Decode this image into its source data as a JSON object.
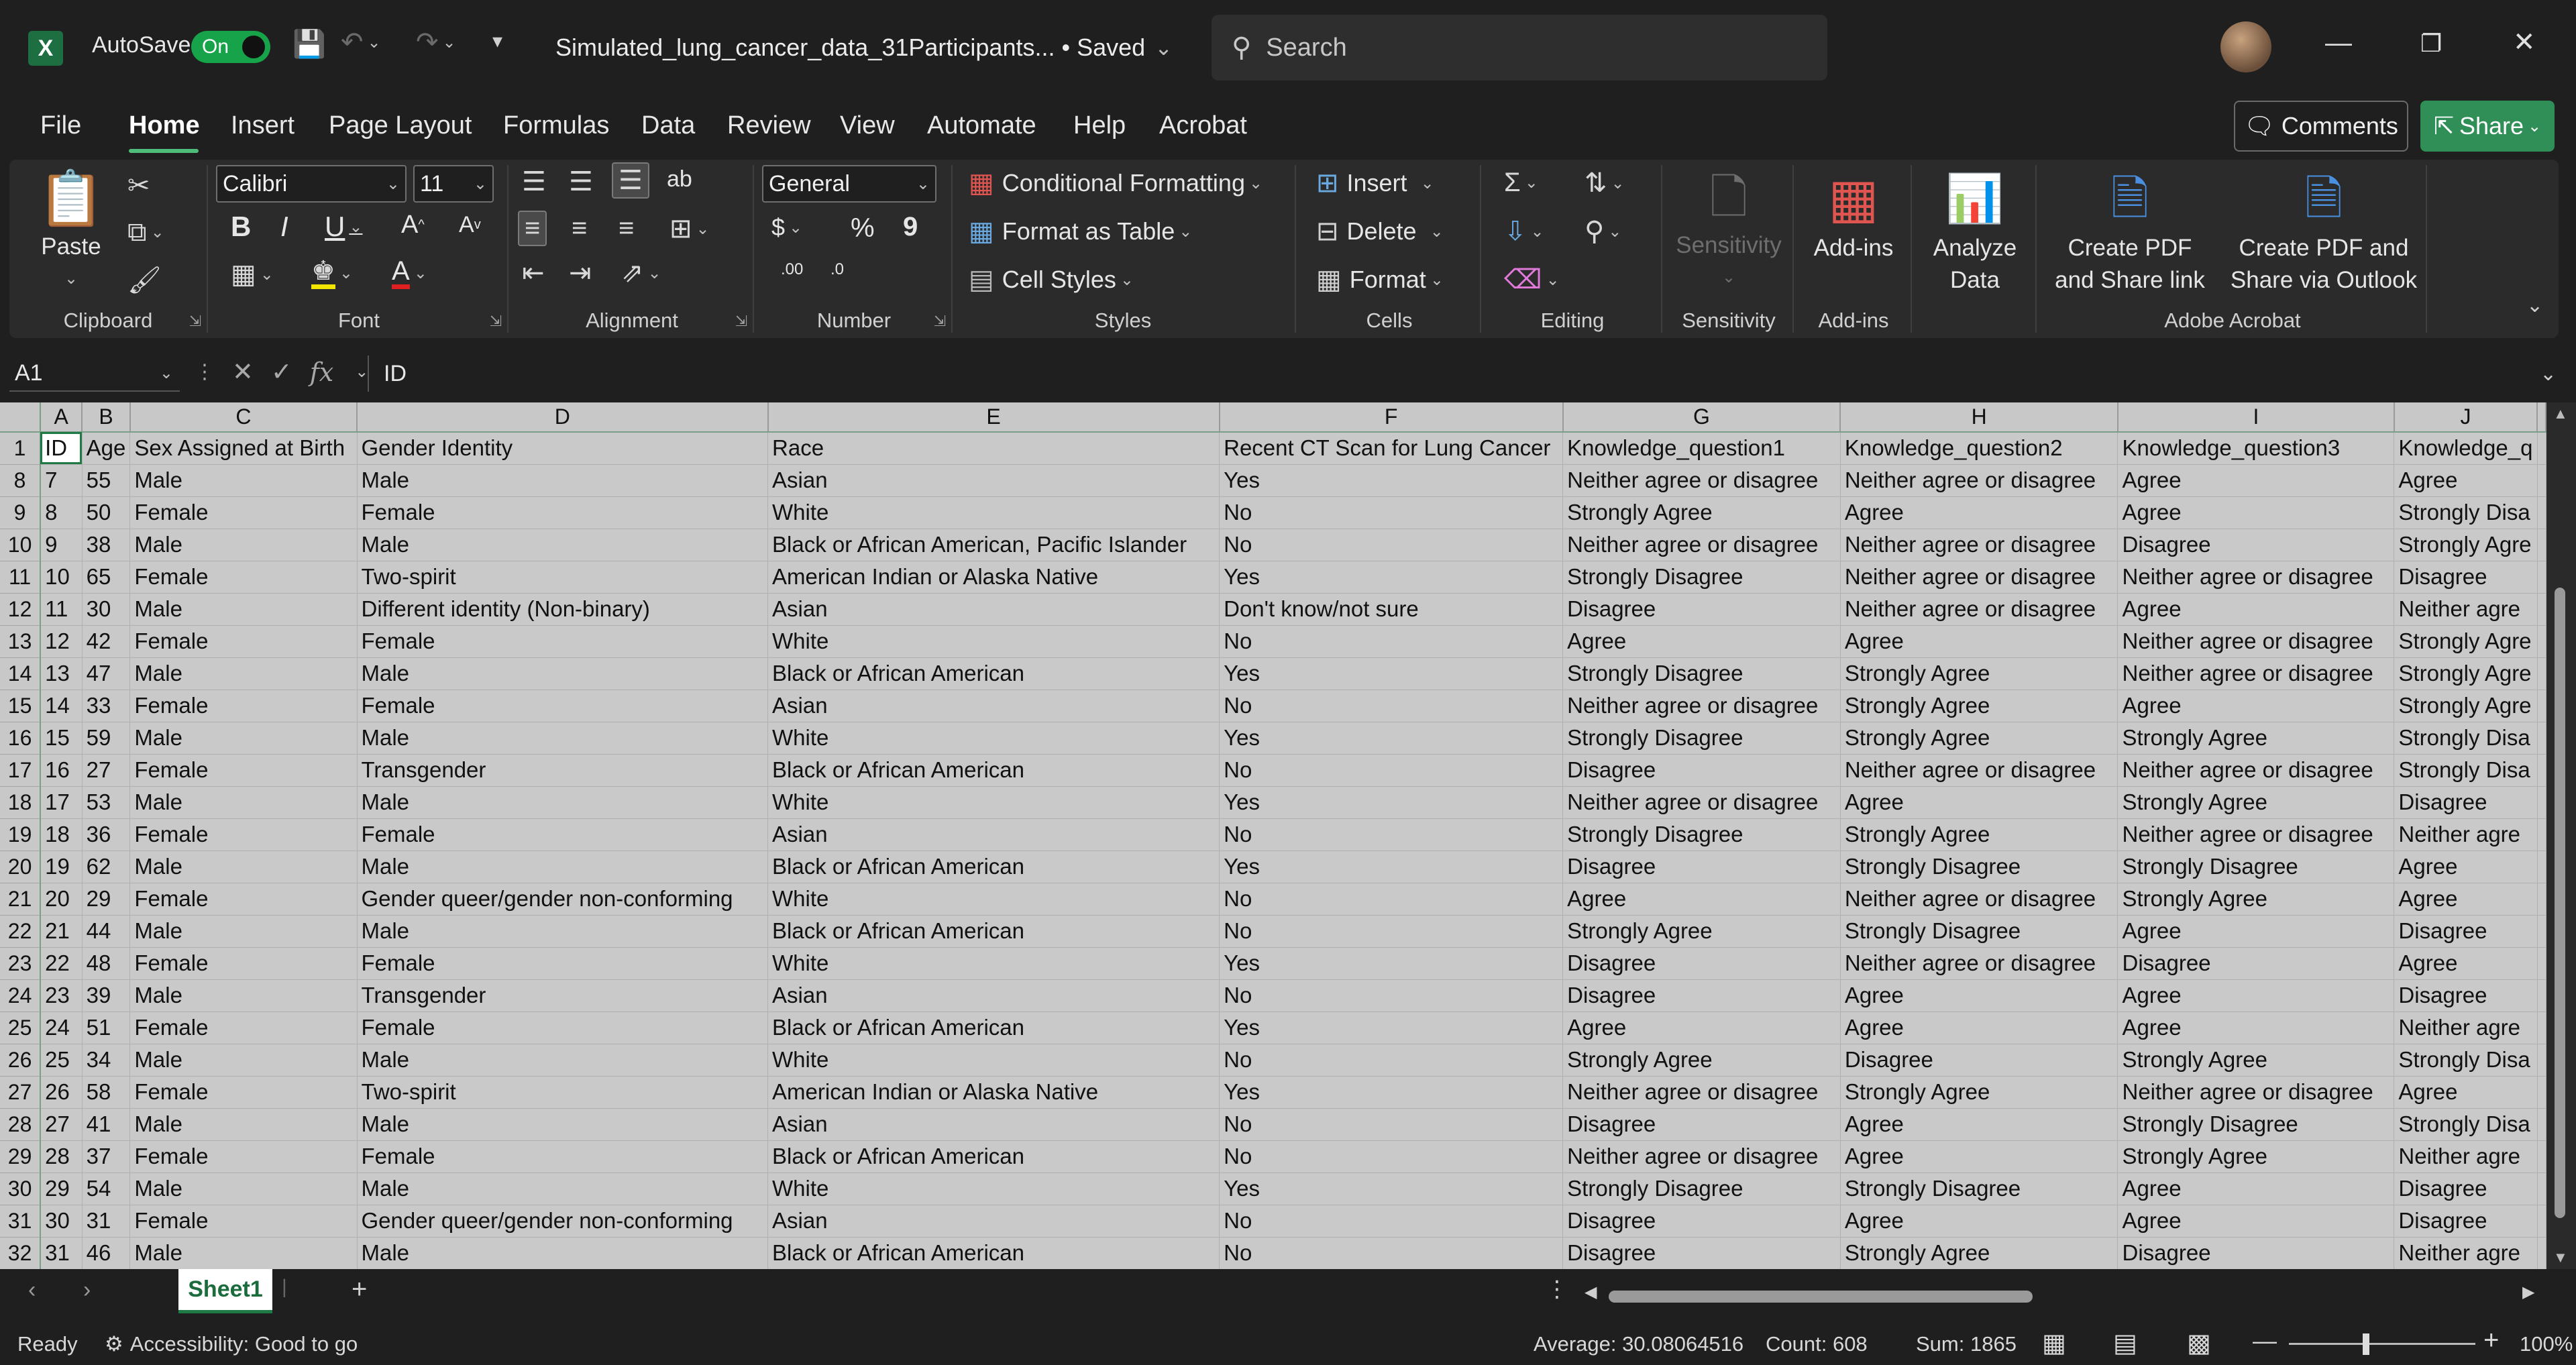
{
  "titlebar": {
    "app_logo": "X",
    "autosave_label": "AutoSave",
    "autosave_state": "On",
    "file_title": "Simulated_lung_cancer_data_31Participants... • Saved",
    "search_placeholder": "Search"
  },
  "menu": {
    "tabs": [
      "File",
      "Home",
      "Insert",
      "Page Layout",
      "Formulas",
      "Data",
      "Review",
      "View",
      "Automate",
      "Help",
      "Acrobat"
    ],
    "comments_label": "Comments",
    "share_label": "Share"
  },
  "ribbon": {
    "clipboard": {
      "paste": "Paste",
      "label": "Clipboard"
    },
    "font": {
      "name": "Calibri",
      "size": "11",
      "label": "Font"
    },
    "alignment": {
      "label": "Alignment"
    },
    "number": {
      "format": "General",
      "label": "Number"
    },
    "styles": {
      "conditional": "Conditional Formatting",
      "table": "Format as Table",
      "cell_styles": "Cell Styles",
      "label": "Styles"
    },
    "cells": {
      "insert": "Insert",
      "delete": "Delete",
      "format": "Format",
      "label": "Cells"
    },
    "editing": {
      "label": "Editing"
    },
    "sensitivity": {
      "button": "Sensitivity",
      "label": "Sensitivity"
    },
    "addins": {
      "button": "Add-ins",
      "label": "Add-ins"
    },
    "analyze": {
      "line1": "Analyze",
      "line2": "Data"
    },
    "acrobat": {
      "pdf_share_1": "Create PDF",
      "pdf_share_2": "and Share link",
      "pdf_outlook_1": "Create PDF and",
      "pdf_outlook_2": "Share via Outlook",
      "label": "Adobe Acrobat"
    },
    "number_symbols": {
      "currency": "$",
      "percent": "%",
      "comma": "9",
      "inc_dec": ".00",
      "dec_dec": ".0"
    }
  },
  "formula_bar": {
    "name_box": "A1",
    "value": "ID"
  },
  "grid": {
    "columns": [
      "A",
      "B",
      "C",
      "D",
      "E",
      "F",
      "G",
      "H",
      "I",
      "J"
    ],
    "header_row_num": "1",
    "header": [
      "ID",
      "Age",
      "Sex Assigned at Birth",
      "Gender Identity",
      "Race",
      "Recent CT Scan for Lung Cancer",
      "Knowledge_question1",
      "Knowledge_question2",
      "Knowledge_question3",
      "Knowledge_q"
    ],
    "rows": [
      {
        "n": "8",
        "c": [
          "7",
          "55",
          "Male",
          "Male",
          "Asian",
          "Yes",
          "Neither agree or disagree",
          "Neither agree or disagree",
          "Agree",
          "Agree"
        ]
      },
      {
        "n": "9",
        "c": [
          "8",
          "50",
          "Female",
          "Female",
          "White",
          "No",
          "Strongly Agree",
          "Agree",
          "Agree",
          "Strongly Disa"
        ]
      },
      {
        "n": "10",
        "c": [
          "9",
          "38",
          "Male",
          "Male",
          "Black or African American, Pacific Islander",
          "No",
          "Neither agree or disagree",
          "Neither agree or disagree",
          "Disagree",
          "Strongly Agre"
        ]
      },
      {
        "n": "11",
        "c": [
          "10",
          "65",
          "Female",
          "Two-spirit",
          "American Indian or Alaska Native",
          "Yes",
          "Strongly Disagree",
          "Neither agree or disagree",
          "Neither agree or disagree",
          "Disagree"
        ]
      },
      {
        "n": "12",
        "c": [
          "11",
          "30",
          "Male",
          "Different identity (Non-binary)",
          "Asian",
          "Don't know/not sure",
          "Disagree",
          "Neither agree or disagree",
          "Agree",
          "Neither agre"
        ]
      },
      {
        "n": "13",
        "c": [
          "12",
          "42",
          "Female",
          "Female",
          "White",
          "No",
          "Agree",
          "Agree",
          "Neither agree or disagree",
          "Strongly Agre"
        ]
      },
      {
        "n": "14",
        "c": [
          "13",
          "47",
          "Male",
          "Male",
          "Black or African American",
          "Yes",
          "Strongly Disagree",
          "Strongly Agree",
          "Neither agree or disagree",
          "Strongly Agre"
        ]
      },
      {
        "n": "15",
        "c": [
          "14",
          "33",
          "Female",
          "Female",
          "Asian",
          "No",
          "Neither agree or disagree",
          "Strongly Agree",
          "Agree",
          "Strongly Agre"
        ]
      },
      {
        "n": "16",
        "c": [
          "15",
          "59",
          "Male",
          "Male",
          "White",
          "Yes",
          "Strongly Disagree",
          "Strongly Agree",
          "Strongly Agree",
          "Strongly Disa"
        ]
      },
      {
        "n": "17",
        "c": [
          "16",
          "27",
          "Female",
          "Transgender",
          "Black or African American",
          "No",
          "Disagree",
          "Neither agree or disagree",
          "Neither agree or disagree",
          "Strongly Disa"
        ]
      },
      {
        "n": "18",
        "c": [
          "17",
          "53",
          "Male",
          "Male",
          "White",
          "Yes",
          "Neither agree or disagree",
          "Agree",
          "Strongly Agree",
          "Disagree"
        ]
      },
      {
        "n": "19",
        "c": [
          "18",
          "36",
          "Female",
          "Female",
          "Asian",
          "No",
          "Strongly Disagree",
          "Strongly Agree",
          "Neither agree or disagree",
          "Neither agre"
        ]
      },
      {
        "n": "20",
        "c": [
          "19",
          "62",
          "Male",
          "Male",
          "Black or African American",
          "Yes",
          "Disagree",
          "Strongly Disagree",
          "Strongly Disagree",
          "Agree"
        ]
      },
      {
        "n": "21",
        "c": [
          "20",
          "29",
          "Female",
          "Gender queer/gender non-conforming",
          "White",
          "No",
          "Agree",
          "Neither agree or disagree",
          "Strongly Agree",
          "Agree"
        ]
      },
      {
        "n": "22",
        "c": [
          "21",
          "44",
          "Male",
          "Male",
          "Black or African American",
          "No",
          "Strongly Agree",
          "Strongly Disagree",
          "Agree",
          "Disagree"
        ]
      },
      {
        "n": "23",
        "c": [
          "22",
          "48",
          "Female",
          "Female",
          "White",
          "Yes",
          "Disagree",
          "Neither agree or disagree",
          "Disagree",
          "Agree"
        ]
      },
      {
        "n": "24",
        "c": [
          "23",
          "39",
          "Male",
          "Transgender",
          "Asian",
          "No",
          "Disagree",
          "Agree",
          "Agree",
          "Disagree"
        ]
      },
      {
        "n": "25",
        "c": [
          "24",
          "51",
          "Female",
          "Female",
          "Black or African American",
          "Yes",
          "Agree",
          "Agree",
          "Agree",
          "Neither agre"
        ]
      },
      {
        "n": "26",
        "c": [
          "25",
          "34",
          "Male",
          "Male",
          "White",
          "No",
          "Strongly Agree",
          "Disagree",
          "Strongly Agree",
          "Strongly Disa"
        ]
      },
      {
        "n": "27",
        "c": [
          "26",
          "58",
          "Female",
          "Two-spirit",
          "American Indian or Alaska Native",
          "Yes",
          "Neither agree or disagree",
          "Strongly Agree",
          "Neither agree or disagree",
          "Agree"
        ]
      },
      {
        "n": "28",
        "c": [
          "27",
          "41",
          "Male",
          "Male",
          "Asian",
          "No",
          "Disagree",
          "Agree",
          "Strongly Disagree",
          "Strongly Disa"
        ]
      },
      {
        "n": "29",
        "c": [
          "28",
          "37",
          "Female",
          "Female",
          "Black or African American",
          "No",
          "Neither agree or disagree",
          "Agree",
          "Strongly Agree",
          "Neither agre"
        ]
      },
      {
        "n": "30",
        "c": [
          "29",
          "54",
          "Male",
          "Male",
          "White",
          "Yes",
          "Strongly Disagree",
          "Strongly Disagree",
          "Agree",
          "Disagree"
        ]
      },
      {
        "n": "31",
        "c": [
          "30",
          "31",
          "Female",
          "Gender queer/gender non-conforming",
          "Asian",
          "No",
          "Disagree",
          "Agree",
          "Agree",
          "Disagree"
        ]
      },
      {
        "n": "32",
        "c": [
          "31",
          "46",
          "Male",
          "Male",
          "Black or African American",
          "No",
          "Disagree",
          "Strongly Agree",
          "Disagree",
          "Neither agre"
        ]
      }
    ]
  },
  "sheets": {
    "active": "Sheet1"
  },
  "status": {
    "ready": "Ready",
    "accessibility": "Accessibility: Good to go",
    "average": "Average: 30.08064516",
    "count": "Count: 608",
    "sum": "Sum: 1865",
    "zoom": "100%"
  },
  "colors": {
    "accent_green": "#1f7a45",
    "share_green": "#2f8f57",
    "toggle_green": "#17a34a"
  }
}
